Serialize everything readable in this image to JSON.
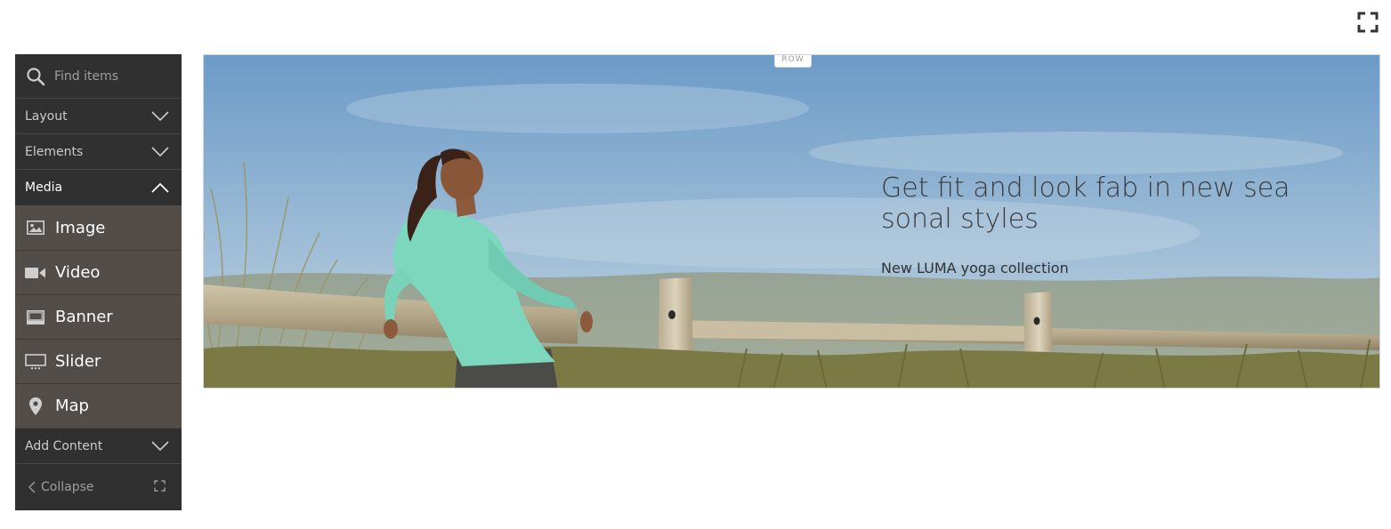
{
  "toolbar": {
    "fullscreen_icon": "fullscreen-expand-icon"
  },
  "sidebar": {
    "search": {
      "placeholder": "Find items",
      "value": ""
    },
    "sections": [
      {
        "label": "Layout",
        "state": "collapsed"
      },
      {
        "label": "Elements",
        "state": "collapsed"
      },
      {
        "label": "Media",
        "state": "expanded"
      }
    ],
    "media_items": [
      {
        "label": "Image",
        "icon": "image-icon"
      },
      {
        "label": "Video",
        "icon": "video-icon"
      },
      {
        "label": "Banner",
        "icon": "banner-icon"
      },
      {
        "label": "Slider",
        "icon": "slider-icon"
      },
      {
        "label": "Map",
        "icon": "map-pin-icon"
      }
    ],
    "add_content": {
      "label": "Add Content",
      "state": "collapsed"
    },
    "collapse_label": "Collapse"
  },
  "stage": {
    "row_label": "ROW",
    "banner": {
      "title": "Get fit and look fab in new seasonal styles",
      "subtitle": "New LUMA yoga collection"
    }
  },
  "colors": {
    "sidebar_bg": "#303030",
    "media_item_bg": "#524d49",
    "sky": "#8fb2d2",
    "shirt": "#7dd8bf"
  }
}
